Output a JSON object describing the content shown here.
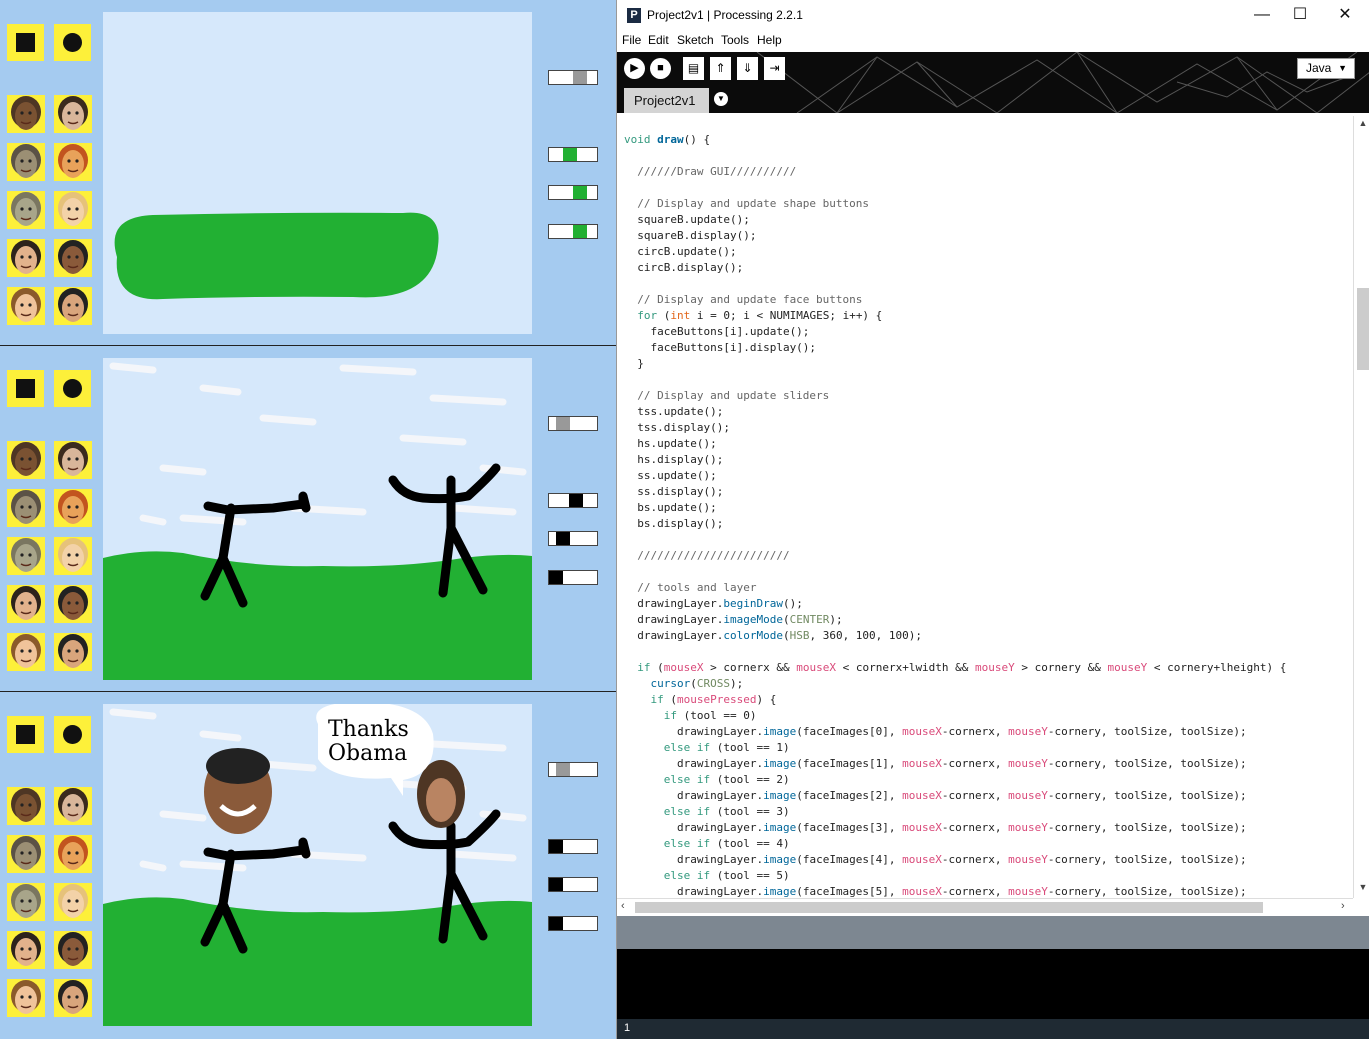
{
  "window": {
    "title": "Project2v1 | Processing 2.2.1",
    "app_logo": "P",
    "minimize": "—",
    "maximize": "☐",
    "close": "✕"
  },
  "menu": [
    "File",
    "Edit",
    "Sketch",
    "Tools",
    "Help"
  ],
  "toolbar": {
    "run_icon": "play-icon",
    "stop_icon": "stop-icon",
    "new_icon": "new-file-icon",
    "open_icon": "open-icon",
    "save_icon": "save-icon",
    "export_icon": "export-icon",
    "mode": "Java"
  },
  "tab": {
    "label": "Project2v1"
  },
  "sketches": [
    {
      "sliders": [
        0.7,
        0.4,
        0.7,
        0.7
      ],
      "slider_colors": [
        "#999999",
        "#22b033",
        "#22b033",
        "#22b033"
      ],
      "speech_bubble": ""
    },
    {
      "sliders": [
        0.2,
        0.6,
        0.2,
        0.0
      ],
      "slider_colors": [
        "#999999",
        "#000000",
        "#000000",
        "#000000"
      ],
      "speech_bubble": ""
    },
    {
      "sliders": [
        0.2,
        0.0,
        0.0,
        0.0
      ],
      "slider_colors": [
        "#999999",
        "#000000",
        "#000000",
        "#000000"
      ],
      "speech_bubble": "Thanks\nObama"
    }
  ],
  "code_lines": [
    "void draw() {",
    "",
    "  //////Draw GUI//////////",
    "",
    "  // Display and update shape buttons",
    "  squareB.update();",
    "  squareB.display();",
    "  circB.update();",
    "  circB.display();",
    "",
    "  // Display and update face buttons",
    "  for (int i = 0; i < NUMIMAGES; i++) {",
    "    faceButtons[i].update();",
    "    faceButtons[i].display();",
    "  }",
    "",
    "  // Display and update sliders",
    "  tss.update();",
    "  tss.display();",
    "  hs.update();",
    "  hs.display();",
    "  ss.update();",
    "  ss.display();",
    "  bs.update();",
    "  bs.display();",
    "",
    "  ///////////////////////",
    "",
    "  // tools and layer",
    "  drawingLayer.beginDraw();",
    "  drawingLayer.imageMode(CENTER);",
    "  drawingLayer.colorMode(HSB, 360, 100, 100);",
    "",
    "  if (mouseX > cornerx && mouseX < cornerx+lwidth && mouseY > cornery && mouseY < cornery+lheight) {",
    "    cursor(CROSS);",
    "    if (mousePressed) {",
    "      if (tool == 0)",
    "        drawingLayer.image(faceImages[0], mouseX-cornerx, mouseY-cornery, toolSize, toolSize);",
    "      else if (tool == 1)",
    "        drawingLayer.image(faceImages[1], mouseX-cornerx, mouseY-cornery, toolSize, toolSize);",
    "      else if (tool == 2)",
    "        drawingLayer.image(faceImages[2], mouseX-cornerx, mouseY-cornery, toolSize, toolSize);",
    "      else if (tool == 3)",
    "        drawingLayer.image(faceImages[3], mouseX-cornerx, mouseY-cornery, toolSize, toolSize);",
    "      else if (tool == 4)",
    "        drawingLayer.image(faceImages[4], mouseX-cornerx, mouseY-cornery, toolSize, toolSize);",
    "      else if (tool == 5)",
    "        drawingLayer.image(faceImages[5], mouseX-cornerx, mouseY-cornery, toolSize, toolSize);"
  ],
  "syntax_colors": {
    "keyword": "#33997e",
    "function": "#006699",
    "type": "#e2661a",
    "variable": "#d94a7a",
    "comment": "#666666",
    "constant": "#718a62"
  },
  "status": {
    "line_number": "1"
  }
}
